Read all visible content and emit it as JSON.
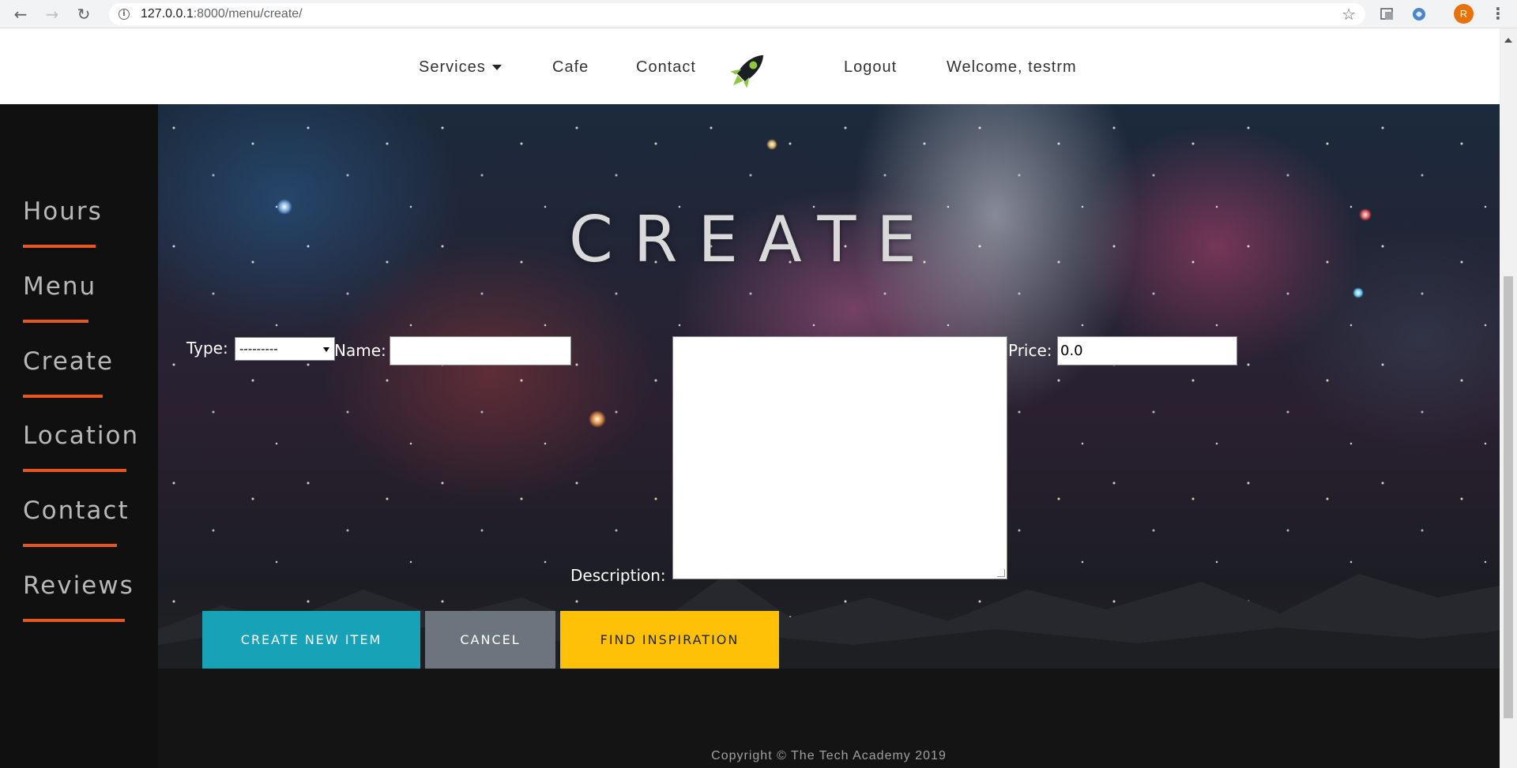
{
  "browser": {
    "url_host": "127.0.0.1",
    "url_rest": ":8000/menu/create/",
    "avatar_letter": "R"
  },
  "topnav": {
    "services": "Services",
    "cafe": "Cafe",
    "contact": "Contact",
    "logout": "Logout",
    "welcome": "Welcome, testrm"
  },
  "sidebar": {
    "items": [
      {
        "label": "Hours"
      },
      {
        "label": "Menu"
      },
      {
        "label": "Create"
      },
      {
        "label": "Location"
      },
      {
        "label": "Contact"
      },
      {
        "label": "Reviews"
      }
    ]
  },
  "main": {
    "title": "CREATE",
    "form": {
      "type_label": "Type:",
      "type_value": "---------",
      "name_label": "Name:",
      "name_value": "",
      "description_label": "Description:",
      "description_value": "",
      "price_label": "Price:",
      "price_value": "0.0"
    },
    "buttons": {
      "create": "CREATE NEW ITEM",
      "cancel": "CANCEL",
      "find": "FIND INSPIRATION"
    }
  },
  "footer": {
    "copyright": "Copyright © The Tech Academy 2019"
  },
  "colors": {
    "accent_orange": "#e8551e",
    "create_button": "#17a2b8",
    "cancel_button": "#6c757d",
    "find_button": "#ffc107"
  }
}
